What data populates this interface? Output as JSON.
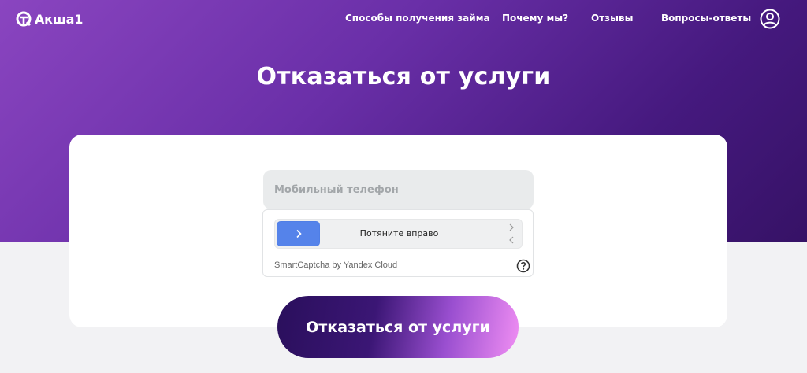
{
  "header": {
    "logo_text": "Акша1",
    "nav": [
      {
        "label": "Способы получения займа"
      },
      {
        "label": "Почему мы?"
      },
      {
        "label": "Отзывы"
      },
      {
        "label": "Вопросы-ответы"
      }
    ],
    "profile_icon": "user-circle-icon"
  },
  "page": {
    "title": "Отказаться от услуги"
  },
  "form": {
    "phone_placeholder": "Мобильный телефон",
    "phone_value": "",
    "captcha": {
      "slider_label": "Потяните вправо",
      "brand": "SmartCaptcha by Yandex Cloud",
      "help_icon": "question-circle-icon"
    },
    "submit_label": "Отказаться от услуги"
  },
  "colors": {
    "hero_gradient_start": "#8a45c0",
    "hero_gradient_end": "#361266",
    "slider_handle": "#5583ea",
    "button_gradient_start": "#2a0f5c",
    "button_gradient_end": "#f08ef3"
  }
}
